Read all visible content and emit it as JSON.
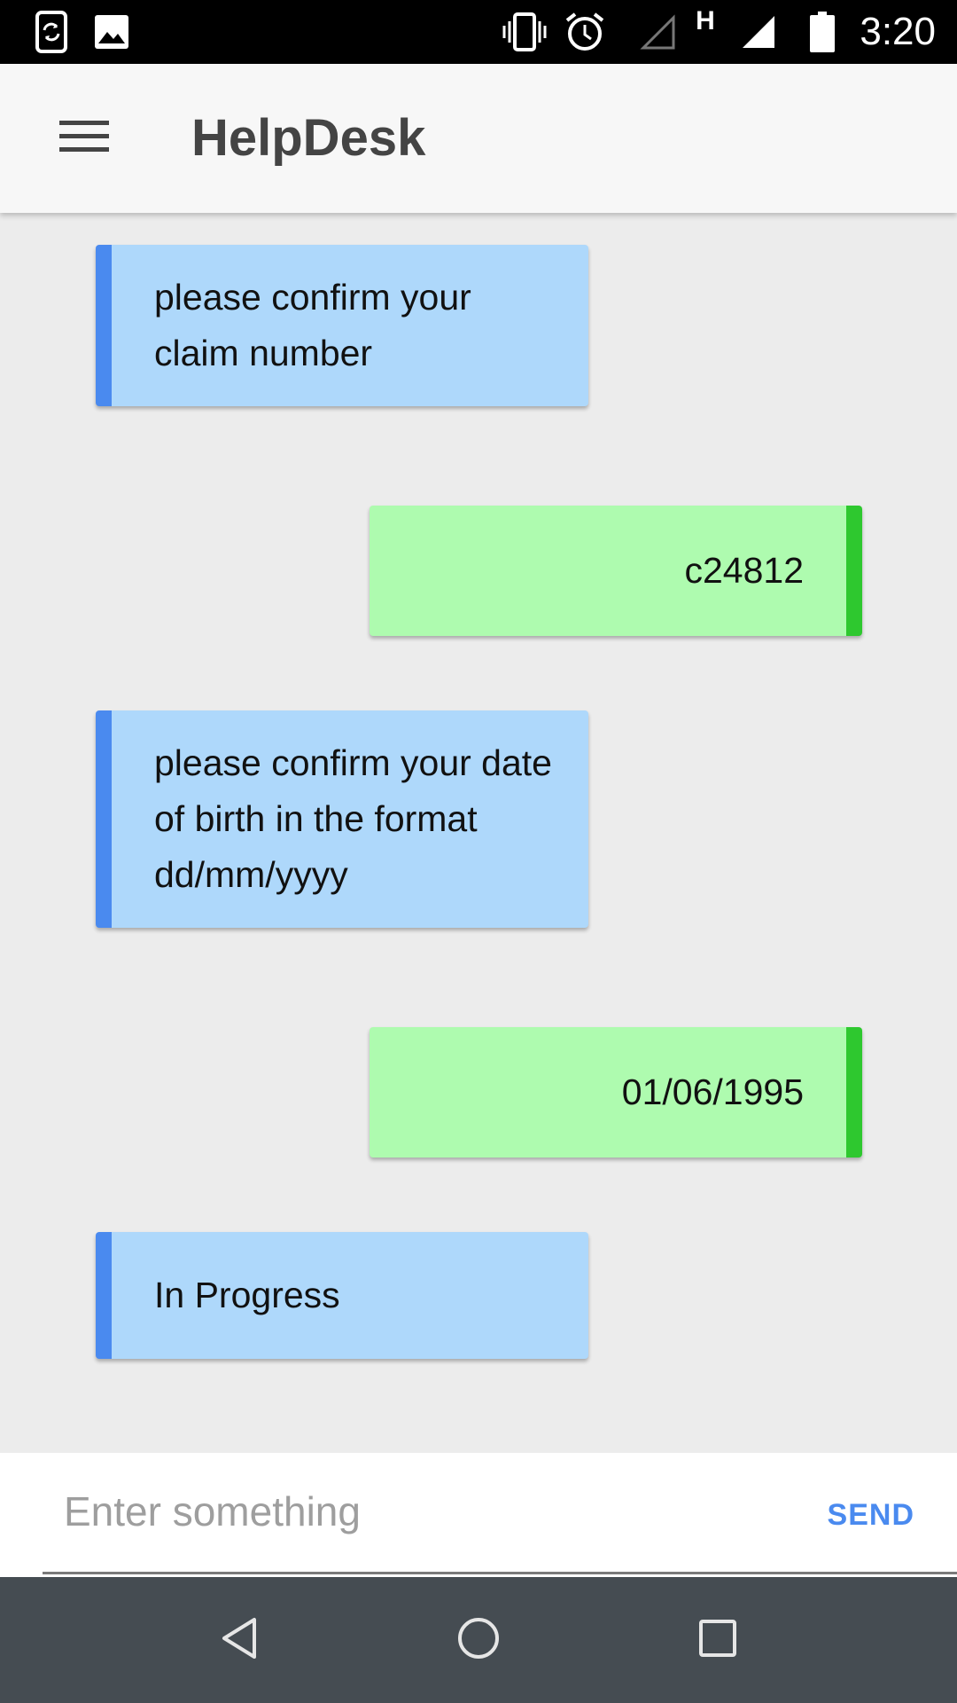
{
  "status_bar": {
    "time": "3:20",
    "icons": [
      "screen-rotation-icon",
      "image-icon",
      "vibrate-icon",
      "alarm-icon",
      "no-signal-icon",
      "h-network-icon",
      "signal-icon",
      "battery-icon"
    ],
    "network_label": "H"
  },
  "app_bar": {
    "title": "HelpDesk",
    "menu_icon": "hamburger-menu-icon"
  },
  "messages": [
    {
      "sender": "bot",
      "text": "please confirm your claim number"
    },
    {
      "sender": "user",
      "text": "c24812"
    },
    {
      "sender": "bot",
      "text": "please confirm your date of birth in the format dd/mm/yyyy"
    },
    {
      "sender": "user",
      "text": "01/06/1995"
    },
    {
      "sender": "bot",
      "text": "In Progress"
    }
  ],
  "composer": {
    "placeholder": "Enter something",
    "value": "",
    "send_label": "SEND"
  },
  "nav_bar": {
    "icons": [
      "back-icon",
      "home-icon",
      "recents-icon"
    ]
  },
  "colors": {
    "bot_bubble": "#aed8fb",
    "bot_accent": "#4a8aef",
    "user_bubble": "#aefbaf",
    "user_accent": "#2ec82f",
    "send_text": "#4a8aef"
  }
}
